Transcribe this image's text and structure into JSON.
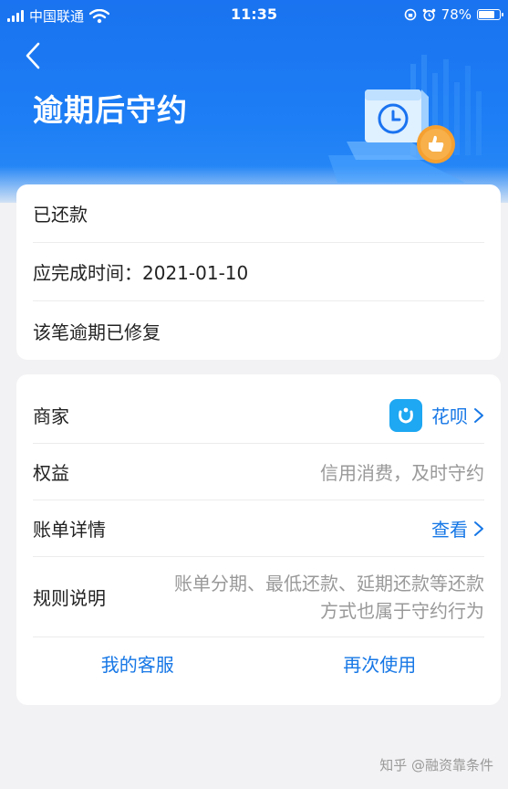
{
  "status_bar": {
    "carrier": "中国联通",
    "time": "11:35",
    "battery": "78%",
    "battery_level": 0.78
  },
  "header": {
    "title": "逾期后守约",
    "back_icon": "chevron-left-icon",
    "illustration_icon": "calendar-clock-thumbs-up-icon"
  },
  "status_card": {
    "items": [
      "已还款",
      "应完成时间：2021-01-10",
      "该笔逾期已修复"
    ]
  },
  "detail_card": {
    "merchant_label": "商家",
    "merchant_value": "花呗",
    "merchant_icon": "huabei-logo-icon",
    "rights_label": "权益",
    "rights_value": "信用消费，及时守约",
    "bill_label": "账单详情",
    "bill_link": "查看",
    "rules_label": "规则说明",
    "rules_line1": "账单分期、最低还款、延期还款等还款",
    "rules_line2": "方式也属于守约行为",
    "customer_service": "我的客服",
    "use_again": "再次使用"
  },
  "watermark": "知乎 @融资靠条件",
  "colors": {
    "header_blue": "#1a73f0",
    "link_blue": "#1677e6",
    "muted_text": "#999999",
    "badge_orange": "#f5a030",
    "page_bg": "#f2f2f4"
  }
}
